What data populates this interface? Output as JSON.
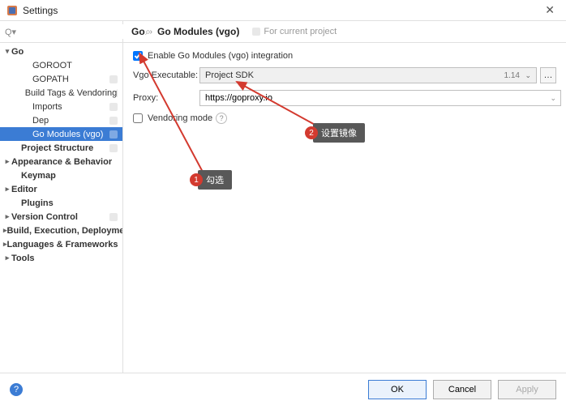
{
  "window": {
    "title": "Settings"
  },
  "search": {
    "placeholder": ""
  },
  "sidebar": {
    "items": [
      {
        "label": "Go",
        "bold": true,
        "arrow": "▾",
        "indent": 0
      },
      {
        "label": "GOROOT",
        "indent": 2
      },
      {
        "label": "GOPATH",
        "indent": 2,
        "badge": true
      },
      {
        "label": "Build Tags & Vendoring",
        "indent": 2,
        "badge": true
      },
      {
        "label": "Imports",
        "indent": 2,
        "badge": true
      },
      {
        "label": "Dep",
        "indent": 2,
        "badge": true
      },
      {
        "label": "Go Modules (vgo)",
        "indent": 2,
        "badge": true,
        "selected": true
      },
      {
        "label": "Project Structure",
        "bold": true,
        "indent": 1,
        "badge": true
      },
      {
        "label": "Appearance & Behavior",
        "bold": true,
        "arrow": "▸",
        "indent": 0
      },
      {
        "label": "Keymap",
        "bold": true,
        "indent": 1
      },
      {
        "label": "Editor",
        "bold": true,
        "arrow": "▸",
        "indent": 0
      },
      {
        "label": "Plugins",
        "bold": true,
        "indent": 1
      },
      {
        "label": "Version Control",
        "bold": true,
        "arrow": "▸",
        "indent": 0,
        "badge": true
      },
      {
        "label": "Build, Execution, Deployment",
        "bold": true,
        "arrow": "▸",
        "indent": 0
      },
      {
        "label": "Languages & Frameworks",
        "bold": true,
        "arrow": "▸",
        "indent": 0
      },
      {
        "label": "Tools",
        "bold": true,
        "arrow": "▸",
        "indent": 0
      }
    ]
  },
  "breadcrumb": {
    "root": "Go",
    "current": "Go Modules (vgo)",
    "hint": "For current project"
  },
  "form": {
    "enable_label": "Enable Go Modules (vgo) integration",
    "enable_checked": true,
    "exec_label": "Vgo Executable:",
    "exec_value": "Project SDK",
    "exec_version": "1.14",
    "proxy_label": "Proxy:",
    "proxy_value": "https://goproxy.io",
    "vendoring_label": "Vendoring mode"
  },
  "footer": {
    "ok": "OK",
    "cancel": "Cancel",
    "apply": "Apply"
  },
  "annotations": {
    "c1_num": "1",
    "c1_text": "勾选",
    "c2_num": "2",
    "c2_text": "设置镜像"
  }
}
